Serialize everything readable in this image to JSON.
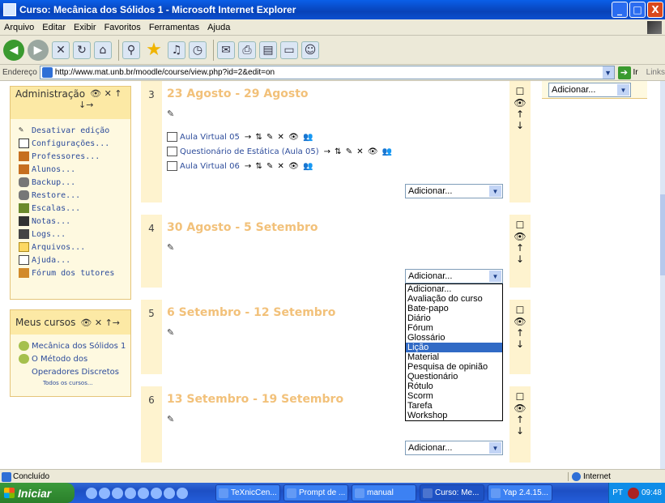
{
  "window": {
    "title": "Curso: Mecânica dos Sólidos 1 - Microsoft Internet Explorer",
    "min": "_",
    "max": "□",
    "close": "X"
  },
  "menu": [
    "Arquivo",
    "Editar",
    "Exibir",
    "Favoritos",
    "Ferramentas",
    "Ajuda"
  ],
  "address": {
    "label": "Endereço",
    "url": "http://www.mat.unb.br/moodle/course/view.php?id=2&edit=on",
    "go_label": "Ir",
    "links_label": "Links"
  },
  "admin_block": {
    "title": "Administração",
    "controls": "👁 ✕ ↑",
    "controls2": "↓→",
    "items": [
      {
        "icon": "edit-icon",
        "label": "Desativar edição"
      },
      {
        "icon": "settings-icon",
        "label": "Configurações..."
      },
      {
        "icon": "teachers-icon",
        "label": "Professores..."
      },
      {
        "icon": "students-icon",
        "label": "Alunos..."
      },
      {
        "icon": "backup-icon",
        "label": "Backup..."
      },
      {
        "icon": "restore-icon",
        "label": "Restore..."
      },
      {
        "icon": "scales-icon",
        "label": "Escalas..."
      },
      {
        "icon": "grades-icon",
        "label": "Notas..."
      },
      {
        "icon": "logs-icon",
        "label": "Logs..."
      },
      {
        "icon": "folder-icon",
        "label": "Arquivos..."
      },
      {
        "icon": "help-icon",
        "label": "Ajuda..."
      },
      {
        "icon": "forum-icon",
        "label": "Fórum dos tutores"
      }
    ]
  },
  "courses_block": {
    "title": "Meus cursos",
    "controls": "👁 ✕ ↑→",
    "items": [
      {
        "label": "Mecânica dos Sólidos 1"
      },
      {
        "label": "O Método dos"
      },
      {
        "label": "Operadores Discretos"
      }
    ],
    "all_courses": "Todos os cursos..."
  },
  "sections": [
    {
      "num": "3",
      "title": "23 Agosto - 29 Agosto",
      "activities": [
        {
          "label": "Aula Virtual 05",
          "tools": "→ ⇅ ✎ ✕ 👁 👥"
        },
        {
          "label": "Questionário de Estática (Aula 05)",
          "tools": "→ ⇅ ✎ ✕ 👁 👥"
        },
        {
          "label": "Aula Virtual 06",
          "tools": "→ ⇅ ✎ ✕ 👁 👥"
        }
      ],
      "select": "Adicionar..."
    },
    {
      "num": "4",
      "title": "30 Agosto - 5 Setembro",
      "activities": [],
      "select": "Adicionar..."
    },
    {
      "num": "5",
      "title": "6 Setembro - 12 Setembro",
      "activities": [],
      "select": ""
    },
    {
      "num": "6",
      "title": "13 Setembro - 19 Setembro",
      "activities": [],
      "select": "Adicionar..."
    }
  ],
  "section_controls": [
    "☐",
    "👁",
    "↑",
    "↓"
  ],
  "right_select": "Adicionar...",
  "dropdown_options": [
    "Adicionar...",
    "Avaliação do curso",
    "Bate-papo",
    "Diário",
    "Fórum",
    "Glossário",
    "Lição",
    "Material",
    "Pesquisa de opinião",
    "Questionário",
    "Rótulo",
    "Scorm",
    "Tarefa",
    "Workshop"
  ],
  "dropdown_selected_index": 6,
  "status": {
    "text": "Concluído",
    "zone": "Internet"
  },
  "taskbar": {
    "start": "Iniciar",
    "buttons": [
      "TeXnicCen...",
      "Prompt de ...",
      "manual",
      "Curso: Me...",
      "Yap 2.4.15..."
    ],
    "lang": "PT",
    "clock": "09:48"
  }
}
